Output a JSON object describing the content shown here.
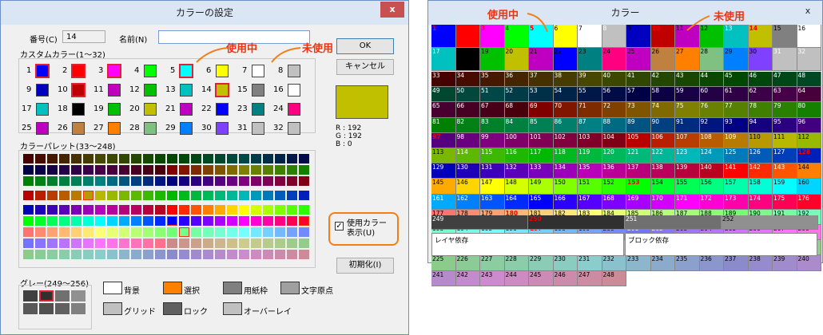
{
  "left": {
    "title": "カラーの設定",
    "close": "x",
    "number_label": "番号(C)",
    "number_value": "14",
    "name_label": "名前(N)",
    "name_value": "",
    "ok": "OK",
    "cancel": "キャンセル",
    "custom_label": "カスタムカラー(1～32)",
    "palette_label": "カラーパレット(33～248)",
    "rgb": {
      "r": "R : 192",
      "g": "G : 192",
      "b": "B : 0"
    },
    "selected_color": "#c0c000",
    "used_checkbox": "使用カラー\n表示(U)",
    "init_button": "初期化(I)",
    "gray_label": "グレー(249～256)",
    "legend": [
      {
        "label": "背景",
        "color": "#ffffff"
      },
      {
        "label": "選択",
        "color": "#ff8000"
      },
      {
        "label": "用紙枠",
        "color": "#808080"
      },
      {
        "label": "文字原点",
        "color": "#a0a0a0"
      },
      {
        "label": "グリッド",
        "color": "#c0c0c0"
      },
      {
        "label": "ロック",
        "color": "#606060"
      },
      {
        "label": "オーバーレイ",
        "color": "#c0c0c0"
      }
    ],
    "custom": [
      {
        "n": "1",
        "c": "#0000ff"
      },
      {
        "n": "2",
        "c": "#ff0000"
      },
      {
        "n": "3",
        "c": "#ff00ff"
      },
      {
        "n": "4",
        "c": "#00ff00"
      },
      {
        "n": "5",
        "c": "#00ffff"
      },
      {
        "n": "6",
        "c": "#ffff00"
      },
      {
        "n": "7",
        "c": "#ffffff"
      },
      {
        "n": "8",
        "c": "#c0c0c0"
      },
      {
        "n": "9",
        "c": "#0000c0"
      },
      {
        "n": "10",
        "c": "#c00000"
      },
      {
        "n": "11",
        "c": "#c000c0"
      },
      {
        "n": "12",
        "c": "#00c000"
      },
      {
        "n": "13",
        "c": "#00c0c0"
      },
      {
        "n": "14",
        "c": "#c0c000"
      },
      {
        "n": "15",
        "c": "#808080"
      },
      {
        "n": "16",
        "c": "#ffffff"
      },
      {
        "n": "17",
        "c": "#00c0c0"
      },
      {
        "n": "18",
        "c": "#000000"
      },
      {
        "n": "19",
        "c": "#00c000"
      },
      {
        "n": "20",
        "c": "#c0c000"
      },
      {
        "n": "21",
        "c": "#c000c0"
      },
      {
        "n": "22",
        "c": "#0000ff"
      },
      {
        "n": "23",
        "c": "#008080"
      },
      {
        "n": "24",
        "c": "#ff0080"
      },
      {
        "n": "25",
        "c": "#c000c0"
      },
      {
        "n": "26",
        "c": "#c08040"
      },
      {
        "n": "27",
        "c": "#ff8000"
      },
      {
        "n": "28",
        "c": "#80c080"
      },
      {
        "n": "29",
        "c": "#0080ff"
      },
      {
        "n": "30",
        "c": "#8040ff"
      },
      {
        "n": "31",
        "c": "#c0c0c0"
      },
      {
        "n": "32",
        "c": "#c0c0c0"
      }
    ],
    "used_custom": [
      "1",
      "2",
      "3",
      "5",
      "10",
      "14"
    ]
  },
  "right": {
    "title": "カラー",
    "close": "x",
    "layer_status": "レイヤ依存",
    "block_status": "ブロック依存"
  },
  "callouts": {
    "in_use": "使用中",
    "unused": "未使用"
  }
}
